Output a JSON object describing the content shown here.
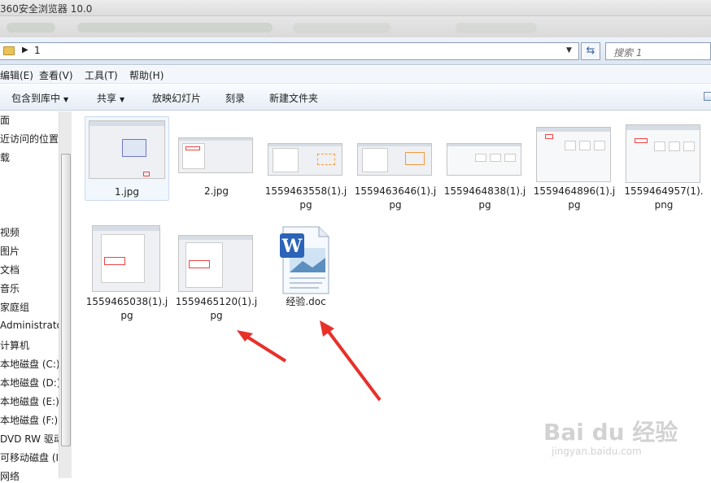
{
  "window": {
    "title": "360安全浏览器 10.0"
  },
  "address": {
    "crumb": "1",
    "search_placeholder": "搜索 1"
  },
  "menubar": {
    "items": [
      "编辑(E)",
      "查看(V)",
      "工具(T)",
      "帮助(H)"
    ]
  },
  "toolbar": {
    "items": [
      "包含到库中",
      "共享",
      "放映幻灯片",
      "刻录",
      "新建文件夹"
    ]
  },
  "nav": {
    "items": [
      "面",
      "近访问的位置",
      "载",
      "视频",
      "图片",
      "文档",
      "音乐",
      "家庭组",
      "Administrator",
      "计算机",
      "本地磁盘 (C:)",
      "本地磁盘 (D:)",
      "本地磁盘 (E:)",
      "本地磁盘 (F:)",
      "DVD RW 驱动器",
      "可移动磁盘 (I:)",
      "网络"
    ]
  },
  "files": [
    {
      "name": "1.jpg",
      "type": "image",
      "selected": true
    },
    {
      "name": "2.jpg",
      "type": "image"
    },
    {
      "name": "1559463558(1).jpg",
      "type": "image"
    },
    {
      "name": "1559463646(1).jpg",
      "type": "image"
    },
    {
      "name": "1559464838(1).jpg",
      "type": "image"
    },
    {
      "name": "1559464896(1).jpg",
      "type": "image"
    },
    {
      "name": "1559464957(1).png",
      "type": "image"
    },
    {
      "name": "1559465038(1).jpg",
      "type": "image"
    },
    {
      "name": "1559465120(1).jpg",
      "type": "image"
    },
    {
      "name": "经验.doc",
      "type": "word-doc"
    }
  ],
  "watermark": {
    "logo": "Bai du 经验",
    "sub": "jingyan.baidu.com"
  },
  "colors": {
    "arrow": "#e8302a",
    "selection": "#c9dbef",
    "toolbar_bg": "#e6edf6"
  }
}
